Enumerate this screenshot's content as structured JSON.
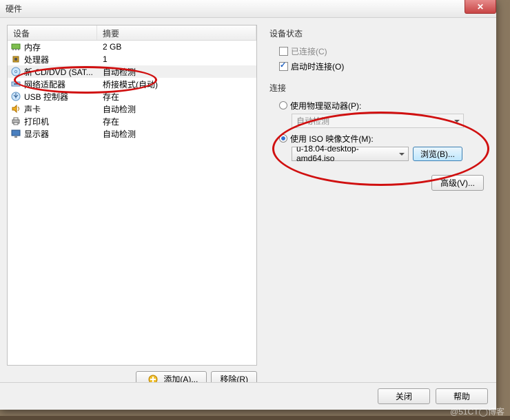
{
  "window": {
    "title": "硬件"
  },
  "list": {
    "headers": {
      "device": "设备",
      "summary": "摘要"
    },
    "rows": [
      {
        "device": "内存",
        "summary": "2 GB",
        "icon": "memory"
      },
      {
        "device": "处理器",
        "summary": "1",
        "icon": "cpu"
      },
      {
        "device": "新 CD/DVD (SAT...",
        "summary": "自动检测",
        "icon": "disc",
        "selected": true
      },
      {
        "device": "网络适配器",
        "summary": "桥接模式(自动)",
        "icon": "network"
      },
      {
        "device": "USB 控制器",
        "summary": "存在",
        "icon": "usb"
      },
      {
        "device": "声卡",
        "summary": "自动检测",
        "icon": "sound"
      },
      {
        "device": "打印机",
        "summary": "存在",
        "icon": "printer"
      },
      {
        "device": "显示器",
        "summary": "自动检测",
        "icon": "display"
      }
    ]
  },
  "buttons": {
    "add": "添加(A)...",
    "remove": "移除(R)",
    "close": "关闭",
    "help": "帮助",
    "browse": "浏览(B)...",
    "advanced": "高级(V)..."
  },
  "status": {
    "title": "设备状态",
    "connected_label": "已连接(C)",
    "connected_checked": false,
    "connect_on_power_label": "启动时连接(O)",
    "connect_on_power_checked": true
  },
  "connection": {
    "title": "连接",
    "physical_label": "使用物理驱动器(P):",
    "physical_selected": false,
    "physical_drive_value": "自动检测",
    "iso_label": "使用 ISO 映像文件(M):",
    "iso_selected": true,
    "iso_value": "u-18.04-desktop-amd64.iso"
  },
  "watermark": "@51CT◯博客"
}
